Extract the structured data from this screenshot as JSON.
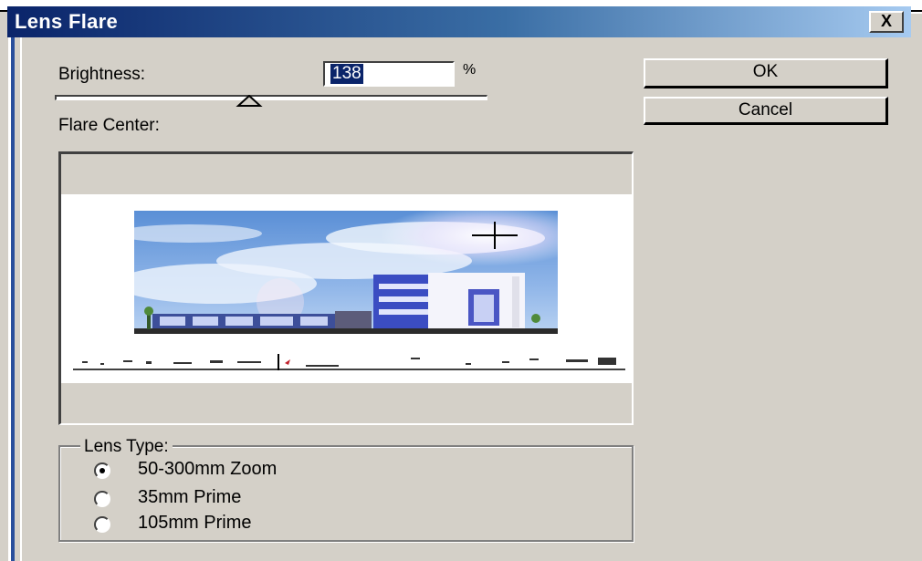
{
  "window": {
    "title": "Lens Flare",
    "close_glyph": "X"
  },
  "brightness": {
    "label": "Brightness:",
    "value": "138",
    "unit": "%",
    "slider_value_percent": 138
  },
  "flare_center": {
    "label": "Flare Center:"
  },
  "buttons": {
    "ok": "OK",
    "cancel": "Cancel"
  },
  "lens_type": {
    "legend": "Lens Type:",
    "options": [
      "50-300mm Zoom",
      "35mm Prime",
      "105mm Prime"
    ],
    "selected": "50-300mm Zoom"
  },
  "colors": {
    "title_start": "#0a246a",
    "title_end": "#a6caf0",
    "face": "#d4d0c8",
    "selection": "#0a246a"
  },
  "icons": [
    "close-icon",
    "slider-thumb-icon",
    "crosshair-icon",
    "radio-icon"
  ]
}
